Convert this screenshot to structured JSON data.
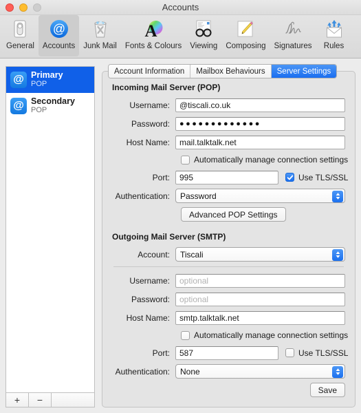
{
  "window": {
    "title": "Accounts",
    "traffic_lights": [
      "close",
      "minimize",
      "zoom"
    ]
  },
  "toolbar": {
    "items": [
      {
        "label": "General",
        "icon": "general-switch-icon",
        "selected": false
      },
      {
        "label": "Accounts",
        "icon": "at-sign-icon",
        "selected": true
      },
      {
        "label": "Junk Mail",
        "icon": "trash-x-icon",
        "selected": false
      },
      {
        "label": "Fonts & Colours",
        "icon": "font-color-wheel-icon",
        "selected": false
      },
      {
        "label": "Viewing",
        "icon": "glasses-icon",
        "selected": false
      },
      {
        "label": "Composing",
        "icon": "pencil-paper-icon",
        "selected": false
      },
      {
        "label": "Signatures",
        "icon": "signature-icon",
        "selected": false
      },
      {
        "label": "Rules",
        "icon": "envelope-arrows-icon",
        "selected": false
      }
    ]
  },
  "sidebar": {
    "accounts": [
      {
        "name": "Primary",
        "type": "POP",
        "selected": true
      },
      {
        "name": "Secondary",
        "type": "POP",
        "selected": false
      }
    ],
    "add_label": "+",
    "remove_label": "−"
  },
  "tabs": [
    {
      "label": "Account Information",
      "selected": false
    },
    {
      "label": "Mailbox Behaviours",
      "selected": false
    },
    {
      "label": "Server Settings",
      "selected": true
    }
  ],
  "incoming": {
    "section_title": "Incoming Mail Server (POP)",
    "username_label": "Username:",
    "username_value": "@tiscali.co.uk",
    "password_label": "Password:",
    "password_value": "●●●●●●●●●●●●●",
    "host_label": "Host Name:",
    "host_value": "mail.talktalk.net",
    "auto_manage_label": "Automatically manage connection settings",
    "auto_manage_checked": false,
    "port_label": "Port:",
    "port_value": "995",
    "tls_label": "Use TLS/SSL",
    "tls_checked": true,
    "auth_label": "Authentication:",
    "auth_value": "Password",
    "advanced_button": "Advanced POP Settings"
  },
  "outgoing": {
    "section_title": "Outgoing Mail Server (SMTP)",
    "account_label": "Account:",
    "account_value": "Tiscali",
    "username_label": "Username:",
    "username_placeholder": "optional",
    "password_label": "Password:",
    "password_placeholder": "optional",
    "host_label": "Host Name:",
    "host_value": "smtp.talktalk.net",
    "auto_manage_label": "Automatically manage connection settings",
    "auto_manage_checked": false,
    "port_label": "Port:",
    "port_value": "587",
    "tls_label": "Use TLS/SSL",
    "tls_checked": false,
    "auth_label": "Authentication:",
    "auth_value": "None"
  },
  "footer": {
    "save_label": "Save"
  },
  "colors": {
    "accent": "#1a6ff0",
    "selection": "#1060e8",
    "window_bg": "#ececec",
    "panel_bg": "#e4e4e4"
  }
}
